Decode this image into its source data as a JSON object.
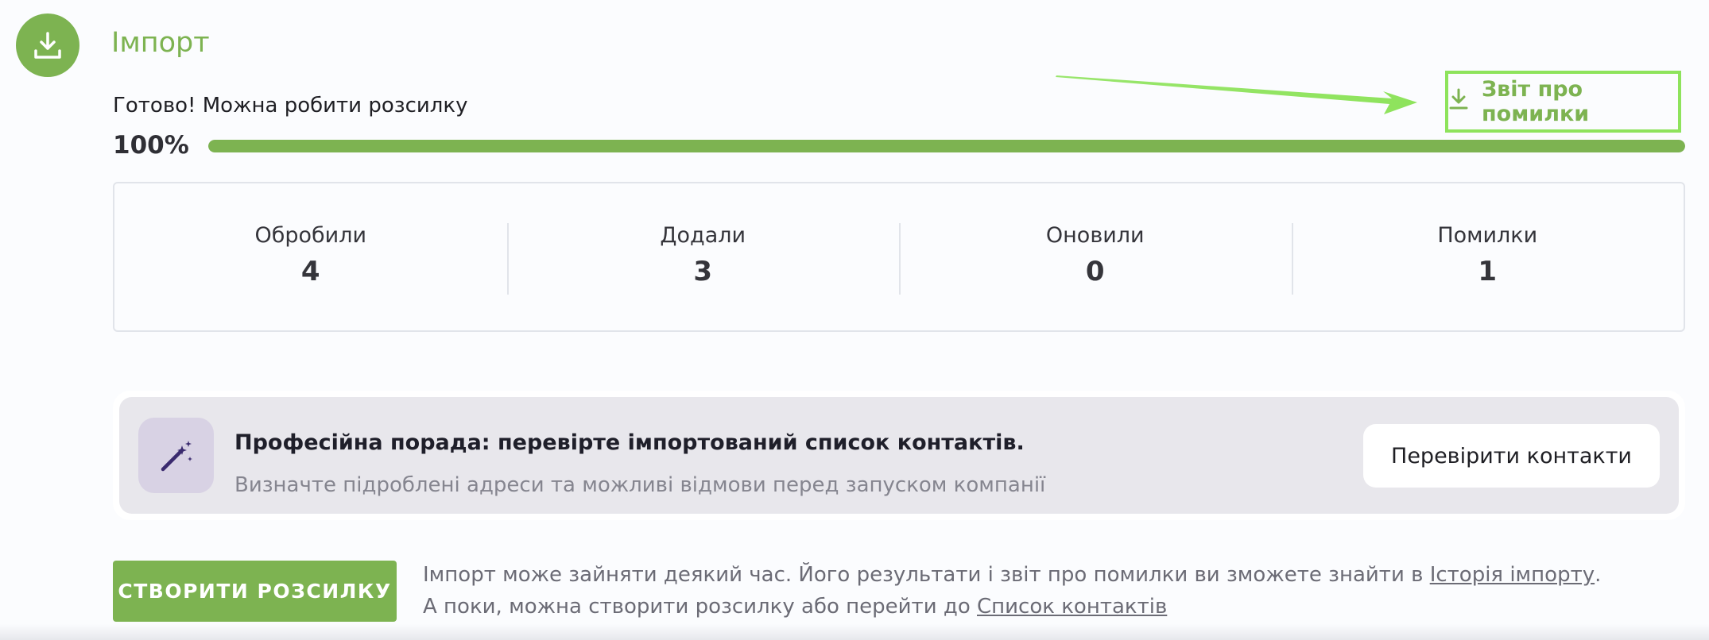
{
  "header": {
    "title": "Імпорт",
    "icon": "download-icon"
  },
  "progress": {
    "status_text": "Готово! Можна робити розсилку",
    "percent_label": "100%",
    "fraction": 1.0,
    "error_report_label": "Звіт про помилки"
  },
  "stats": [
    {
      "label": "Обробили",
      "value": "4"
    },
    {
      "label": "Додали",
      "value": "3"
    },
    {
      "label": "Оновили",
      "value": "0"
    },
    {
      "label": "Помилки",
      "value": "1"
    }
  ],
  "tip": {
    "icon": "magic-wand-icon",
    "title": "Професійна порада: перевірте імпортований список контактів.",
    "description": "Визначте підроблені адреси та можливі відмови перед запуском компанії",
    "button_label": "Перевірити контакти"
  },
  "footer": {
    "create_button_label": "СТВОРИТИ РОЗСИЛКУ",
    "info_line1": "Імпорт може зайняти деякий час. Його результати і звіт про помилки ви зможете знайти в ",
    "history_link": "Історія імпорту",
    "info_line1_end": ".",
    "info_line2": "А поки, можна створити розсилку або перейти до ",
    "contacts_link": "Список контактів"
  },
  "colors": {
    "accent": "#7db351",
    "annotation": "#8ee35c"
  }
}
